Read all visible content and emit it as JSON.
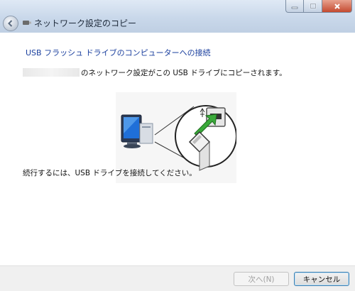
{
  "window": {
    "title": "ネットワーク設定のコピー",
    "controls": {
      "minimize": "–",
      "maximize": "□",
      "close": "✕"
    }
  },
  "content": {
    "heading": "USB フラッシュ ドライブのコンピューターへの接続",
    "message": "のネットワーク設定がこの USB ドライブにコピーされます。",
    "instruction": "続行するには、USB ドライブを接続してください。"
  },
  "footer": {
    "next_label": "次へ(N)",
    "cancel_label": "キャンセル"
  },
  "colors": {
    "heading": "#1a3f9e",
    "arrow": "#3aa93a",
    "accent": "#3c7fb1"
  }
}
